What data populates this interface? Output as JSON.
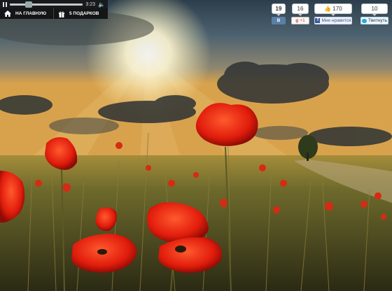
{
  "player": {
    "time": "3:23"
  },
  "nav": {
    "home_label": "НА ГЛАВНУЮ",
    "gifts_label": "5 ПОДАРКОВ"
  },
  "social": {
    "vk": {
      "count": "19",
      "label": "В"
    },
    "gplus": {
      "count": "16",
      "label": "+1"
    },
    "facebook": {
      "count": "170",
      "label": "Мне нравится"
    },
    "twitter": {
      "count": "10",
      "label": "Твитнуть"
    }
  },
  "colors": {
    "poppy": "#e8230e",
    "sky_glow": "#fff6c8",
    "field": "#6e6a2c"
  }
}
